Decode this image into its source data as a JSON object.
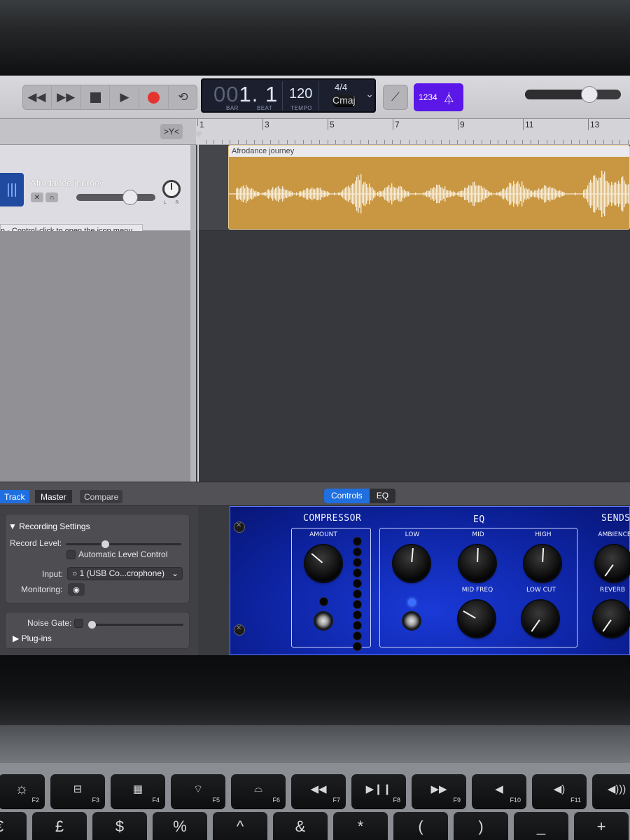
{
  "transport": {
    "rewind_icon": "rewind-icon",
    "forward_icon": "fast-forward-icon",
    "stop_icon": "stop-icon",
    "play_icon": "play-icon",
    "record_icon": "record-icon",
    "cycle_icon": "cycle-icon",
    "record_color": "#e3342f"
  },
  "lcd": {
    "position_dim": "00",
    "position": "1. 1",
    "bar_label": "BAR",
    "beat_label": "BEAT",
    "tempo": "120",
    "tempo_label": "TEMPO",
    "time_signature": "4/4",
    "key": "Cmaj",
    "dropdown_icon": "chevron-down-icon"
  },
  "toolbar": {
    "tuner_icon": "tuner-icon",
    "count_in": "1234",
    "metronome_icon": "metronome-icon",
    "count_in_color": "#5a17e8",
    "master_volume_level": 0.7
  },
  "tracks_header": {
    "filter_icon": "filter-icon"
  },
  "track": {
    "name": "Afrodance journey",
    "icon": "waveform-icon",
    "mute_icon": "speaker-mute-icon",
    "headphones_icon": "headphones-icon",
    "volume_level": 0.72,
    "pan_label": "L  R",
    "tooltip": "n - Control-click to open the icon menu."
  },
  "ruler": {
    "bars": [
      "1",
      "3",
      "5",
      "7",
      "9",
      "11",
      "13"
    ]
  },
  "region": {
    "title": "Afrodance journey",
    "color": "#c99742"
  },
  "smart_controls": {
    "tabs": {
      "track": "Track",
      "master": "Master",
      "compare": "Compare"
    },
    "view_switch": {
      "controls": "Controls",
      "eq": "EQ"
    },
    "recording_settings": {
      "title": "Recording Settings",
      "record_level_label": "Record Level:",
      "record_level_value": 0.33,
      "auto_level_label": "Automatic Level Control",
      "input_label": "Input:",
      "input_value": "1  (USB Co...crophone)",
      "monitoring_label": "Monitoring:"
    },
    "noise_gate_label": "Noise Gate:",
    "plugins_label": "Plug-ins"
  },
  "plugin": {
    "compressor_title": "COMPRESSOR",
    "eq_title": "EQ",
    "sends_title": "SENDS",
    "amount_label": "AMOUNT",
    "low_label": "LOW",
    "mid_label": "MID",
    "high_label": "HIGH",
    "mid_freq_label": "MID FREQ",
    "low_cut_label": "LOW CUT",
    "ambience_label": "AMBIENCE",
    "reverb_label": "REVERB",
    "panel_color": "#0d23a0"
  },
  "keyboard": {
    "f2": "F2",
    "f3": "F3",
    "f4": "F4",
    "f5": "F5",
    "f6": "F6",
    "f7": "F7",
    "f8": "F8",
    "f9": "F9",
    "f10": "F10",
    "f11": "F11",
    "row2": [
      "€",
      "£",
      "$",
      "%",
      "^",
      "&",
      "*",
      "(",
      ")",
      "_",
      "+"
    ]
  }
}
